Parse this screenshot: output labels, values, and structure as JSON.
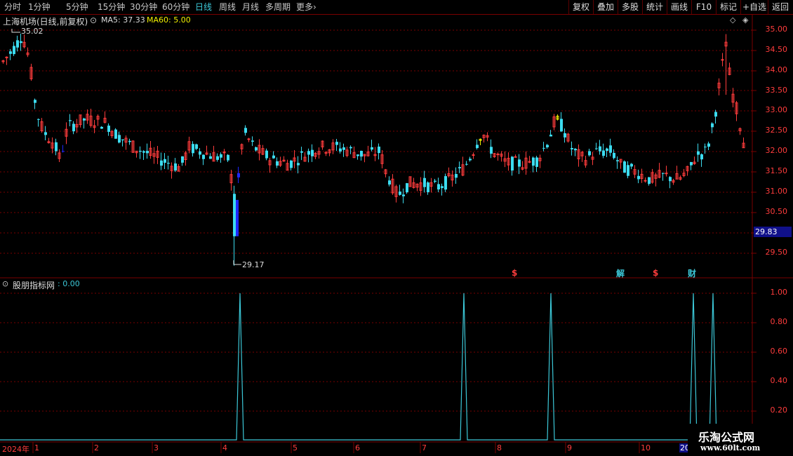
{
  "toolbar": {
    "periods": [
      "分时",
      "1分钟",
      "5分钟",
      "15分钟",
      "30分钟",
      "60分钟",
      "日线",
      "周线",
      "月线",
      "多周期",
      "更多"
    ],
    "active_period": "日线",
    "more_arrow": "›",
    "buttons": [
      "复权",
      "叠加",
      "多股",
      "统计",
      "画线",
      "F10",
      "标记",
      "+自选",
      "返回"
    ]
  },
  "main_chart": {
    "title": "上海机场(日线,前复权)",
    "ma5_label": "MA5: 37.33",
    "ma60_label": "MA60: 5.00",
    "high_annotation": "35.02",
    "low_annotation": "29.17",
    "current_price": "29.83",
    "price_axis": [
      "35.00",
      "34.50",
      "34.00",
      "33.50",
      "33.00",
      "32.50",
      "32.00",
      "31.50",
      "31.00",
      "30.50",
      "29.50"
    ],
    "event_markers": [
      {
        "text": "$",
        "color": "#ff3c3c"
      },
      {
        "text": "解",
        "color": "#3cc8d8"
      },
      {
        "text": "$",
        "color": "#ff3c3c"
      },
      {
        "text": "财",
        "color": "#3cc8d8"
      }
    ]
  },
  "indicator": {
    "title": "股朋指标网",
    "value_label": ": 0.00",
    "axis": [
      "1.00",
      "0.80",
      "0.60",
      "0.40",
      "0.20"
    ],
    "spike_months": [
      "4",
      "7",
      "8",
      "12",
      "12"
    ]
  },
  "time_axis": {
    "year": "2024年",
    "months": [
      "1",
      "2",
      "3",
      "4",
      "5",
      "6",
      "7",
      "8",
      "9",
      "10",
      "20"
    ]
  },
  "watermark": {
    "title": "乐淘公式网",
    "url": "www.60lt.com"
  },
  "colors": {
    "up": "#ff3c3c",
    "down": "#3cdcf0",
    "signal": "#3cc8d8",
    "grid": "#7a0000",
    "yellow": "#f0f000",
    "blue": "#1e28ff"
  }
}
